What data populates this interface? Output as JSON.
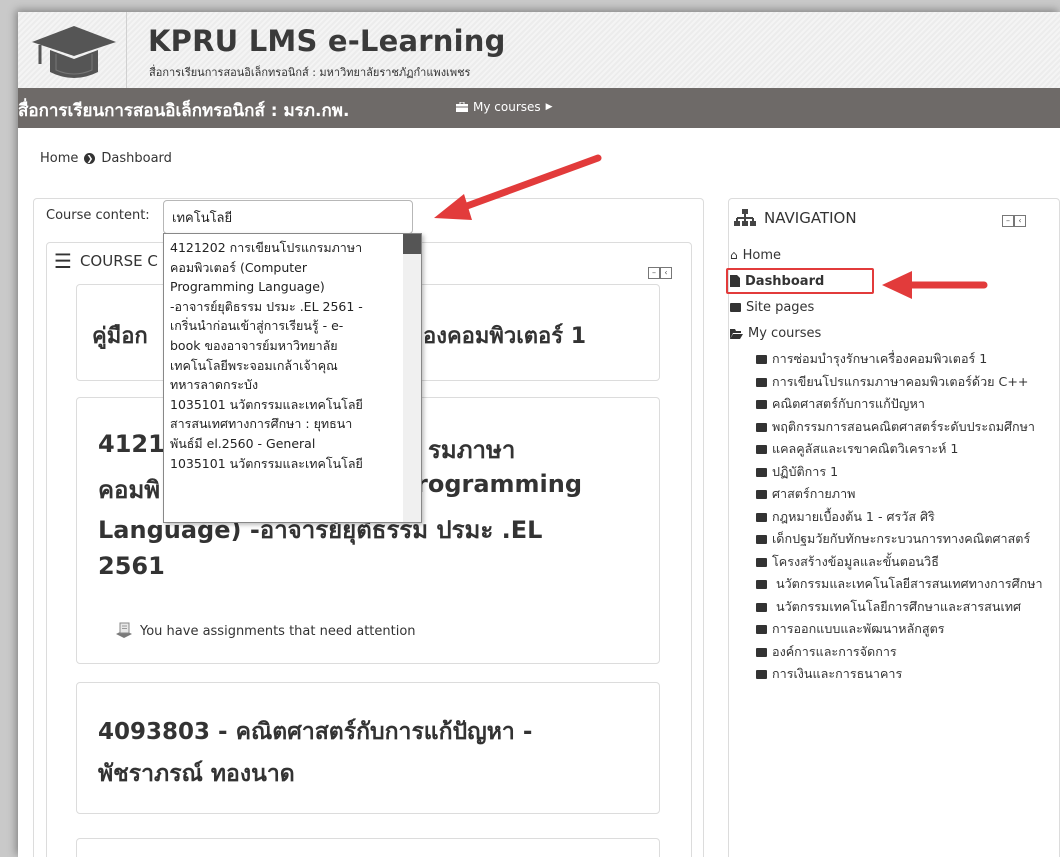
{
  "header": {
    "site_title": "KPRU LMS e-Learning",
    "site_subtitle": "สื่อการเรียนการสอนอิเล็กทรอนิกส์ : มหาวิทยาลัยราชภัฏกำแพงเพชร"
  },
  "navbar": {
    "brand": "สื่อการเรียนการสอนอิเล็กทรอนิกส์ : มรภ.กพ.",
    "my_courses": "My courses"
  },
  "breadcrumb": {
    "home": "Home",
    "current": "Dashboard"
  },
  "course_content": {
    "label": "Course content:",
    "input_value": "เทคโนโลยี"
  },
  "dropdown": {
    "lines": [
      "4121202 การเขียนโปรแกรมภาษา",
      "คอมพิวเตอร์ (Computer",
      "Programming Language)",
      "-อาจารย์ยุติธรรม ปรมะ .EL 2561 -",
      "เกริ่นนำก่อนเข้าสู่การเรียนรู้ - e-",
      "book ของอาจารย์มหาวิทยาลัย",
      "เทคโนโลยีพระจอมเกล้าเจ้าคุณ",
      "ทหารลาดกระบัง",
      "1035101 นวัตกรรมและเทคโนโลยี",
      "สารสนเทศทางการศึกษา : ยุทธนา",
      "พันธ์มี el.2560 - General",
      "1035101 นวัตกรรมและเทคโนโลยี"
    ]
  },
  "course_block": {
    "header_visible": "COURSE C"
  },
  "courses_main": {
    "card1_visible": "คู่มือก",
    "card1_visible_right": "องคอมพิวเตอร์ 1",
    "card2_line1": "4121",
    "card2_line1_right": "รมภาษา",
    "card2_line2": "คอมพิ",
    "card2_line2_right": "rogramming",
    "card2_line3": "Language) -อาจารย์ยุติธรรม ปรมะ .EL",
    "card2_line4": "2561",
    "notice": "You have assignments that need attention",
    "card3_line1": "4093803 - คณิตศาสตร์กับการแก้ปัญหา -",
    "card3_line2": "พัชราภรณ์ ทองนาด"
  },
  "navigation": {
    "title": "NAVIGATION",
    "home": "Home",
    "dashboard": "Dashboard",
    "site_pages": "Site pages",
    "my_courses": "My courses",
    "courses": [
      "การซ่อมบำรุงรักษาเครื่องคอมพิวเตอร์ 1",
      "การเขียนโปรแกรมภาษาคอมพิวเตอร์ด้วย C++",
      "คณิตศาสตร์กับการแก้ปัญหา",
      "พฤติกรรมการสอนคณิตศาสตร์ระดับประถมศึกษา",
      "แคลคูลัสและเรขาคณิตวิเคราะห์ 1",
      "ปฏิบัติการ 1",
      "ศาสตร์กายภาพ",
      "กฎหมายเบื้องต้น 1 - ศรวัส ศิริ",
      "เด็กปฐมวัยกับทักษะกระบวนการทางคณิตศาสตร์",
      "โครงสร้างข้อมูลและขั้นตอนวิธี",
      " นวัตกรรมและเทคโนโลยีสารสนเทศทางการศึกษา",
      " นวัตกรรมเทคโนโลยีการศึกษาและสารสนเทศ",
      "การออกแบบและพัฒนาหลักสูตร",
      "องค์การและการจัดการ",
      "การเงินและการธนาคาร"
    ]
  }
}
